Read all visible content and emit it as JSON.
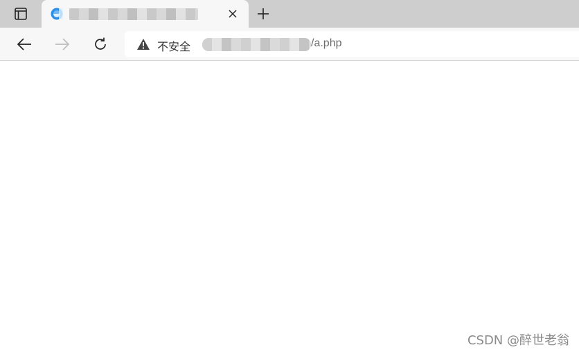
{
  "tab": {
    "title": "",
    "favicon": "ie-browser-icon"
  },
  "toolbar": {
    "back_icon": "arrow-left-icon",
    "forward_icon": "arrow-right-icon",
    "refresh_icon": "refresh-icon"
  },
  "address": {
    "security_label": "不安全",
    "url_host": "",
    "url_path": "/a.php"
  },
  "page": {
    "body_text": ""
  },
  "watermark": "CSDN @醉世老翁",
  "colors": {
    "tabstrip": "#cecece",
    "toolbar": "#f7f7f7",
    "active_tab": "#f7f7f7",
    "favicon": "#2b8fe8"
  }
}
